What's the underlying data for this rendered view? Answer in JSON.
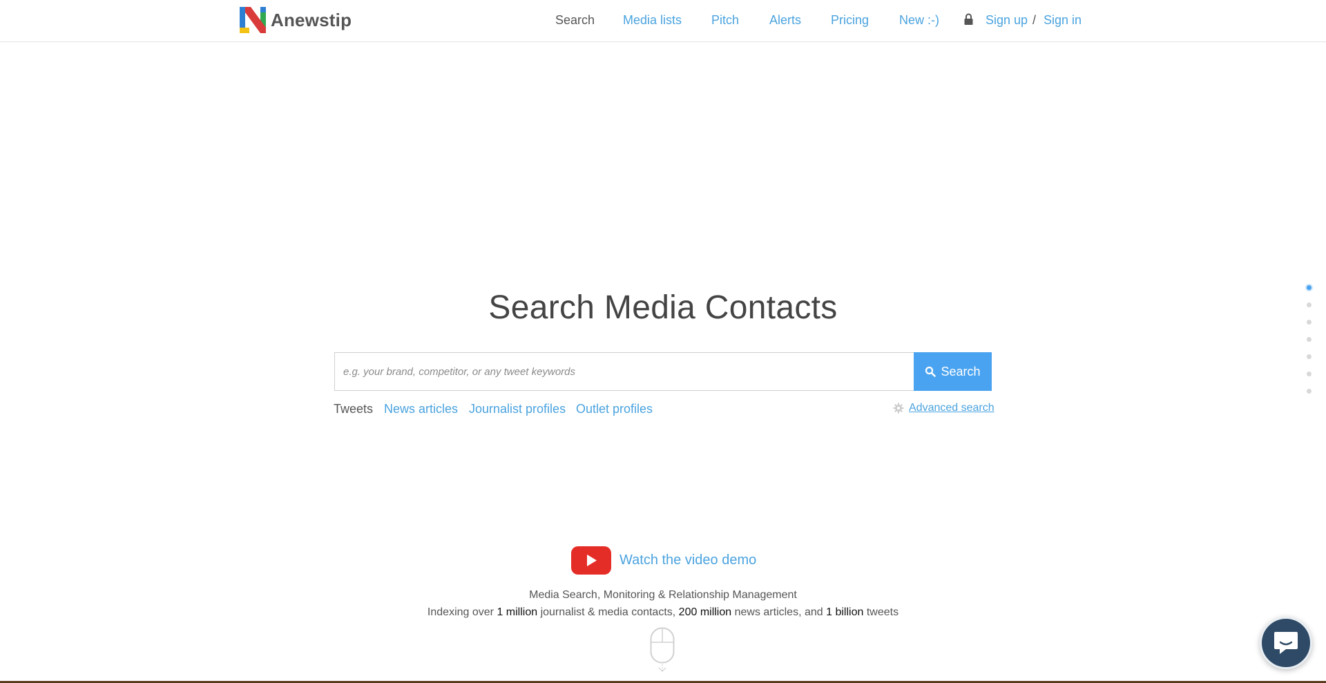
{
  "brand": {
    "name": "Anewstip"
  },
  "nav": {
    "search": "Search",
    "media_lists": "Media lists",
    "pitch": "Pitch",
    "alerts": "Alerts",
    "pricing": "Pricing",
    "new": "New :-)",
    "sign_up": "Sign up",
    "separator": "/",
    "sign_in": "Sign in"
  },
  "hero": {
    "title": "Search Media Contacts",
    "placeholder": "e.g. your brand, competitor, or any tweet keywords",
    "search_button": "Search"
  },
  "search_types": {
    "tweets": "Tweets",
    "news_articles": "News articles",
    "journalist_profiles": "Journalist profiles",
    "outlet_profiles": "Outlet profiles",
    "selected": "Tweets"
  },
  "advanced_search": "Advanced search",
  "video": {
    "label": "Watch the video demo"
  },
  "tagline": "Media Search, Monitoring & Relationship Management",
  "stats": {
    "prefix": "Indexing over ",
    "journalists_count": "1 million",
    "journalists_label": " journalist & media contacts, ",
    "articles_count": "200 million",
    "articles_label": " news articles, and ",
    "tweets_count": "1 billion",
    "tweets_label": " tweets"
  },
  "section_nav": {
    "count": 7,
    "active_index": 0
  },
  "colors": {
    "accent": "#4aa3f0",
    "link": "#4aa3df",
    "youtube": "#e52d27",
    "chat": "#2e4a66"
  },
  "icons": {
    "lock": "lock-icon",
    "search": "search-icon",
    "gear": "gear-icon",
    "play": "youtube-play-icon",
    "scroll": "scroll-mouse-icon",
    "chat": "chat-bubble-icon"
  }
}
